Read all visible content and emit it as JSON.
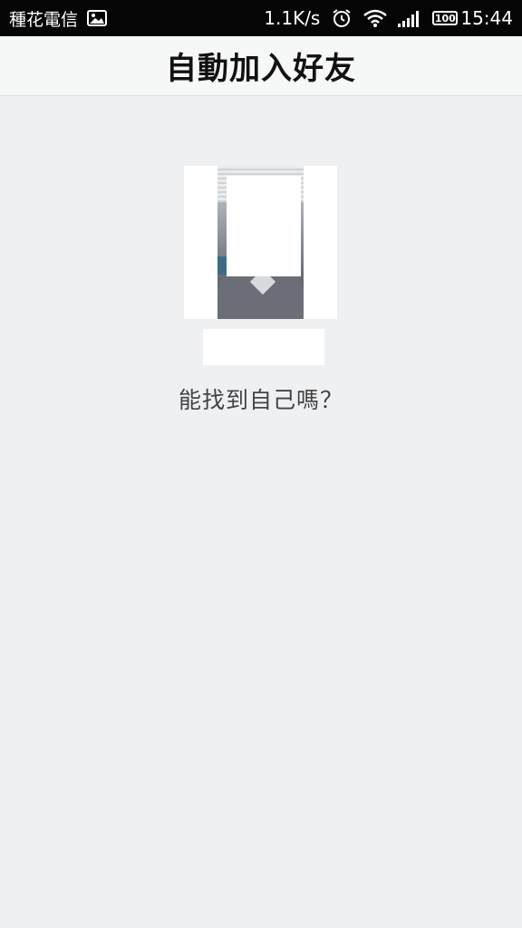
{
  "status_bar": {
    "carrier": "種花電信",
    "net_speed": "1.1K/s",
    "battery": "100",
    "time": "15:44",
    "icons": [
      "gallery-icon",
      "alarm-icon",
      "wifi-icon",
      "signal-icon",
      "battery-icon"
    ]
  },
  "header": {
    "title": "自動加入好友"
  },
  "main": {
    "question": "能找到自己嗎？"
  }
}
